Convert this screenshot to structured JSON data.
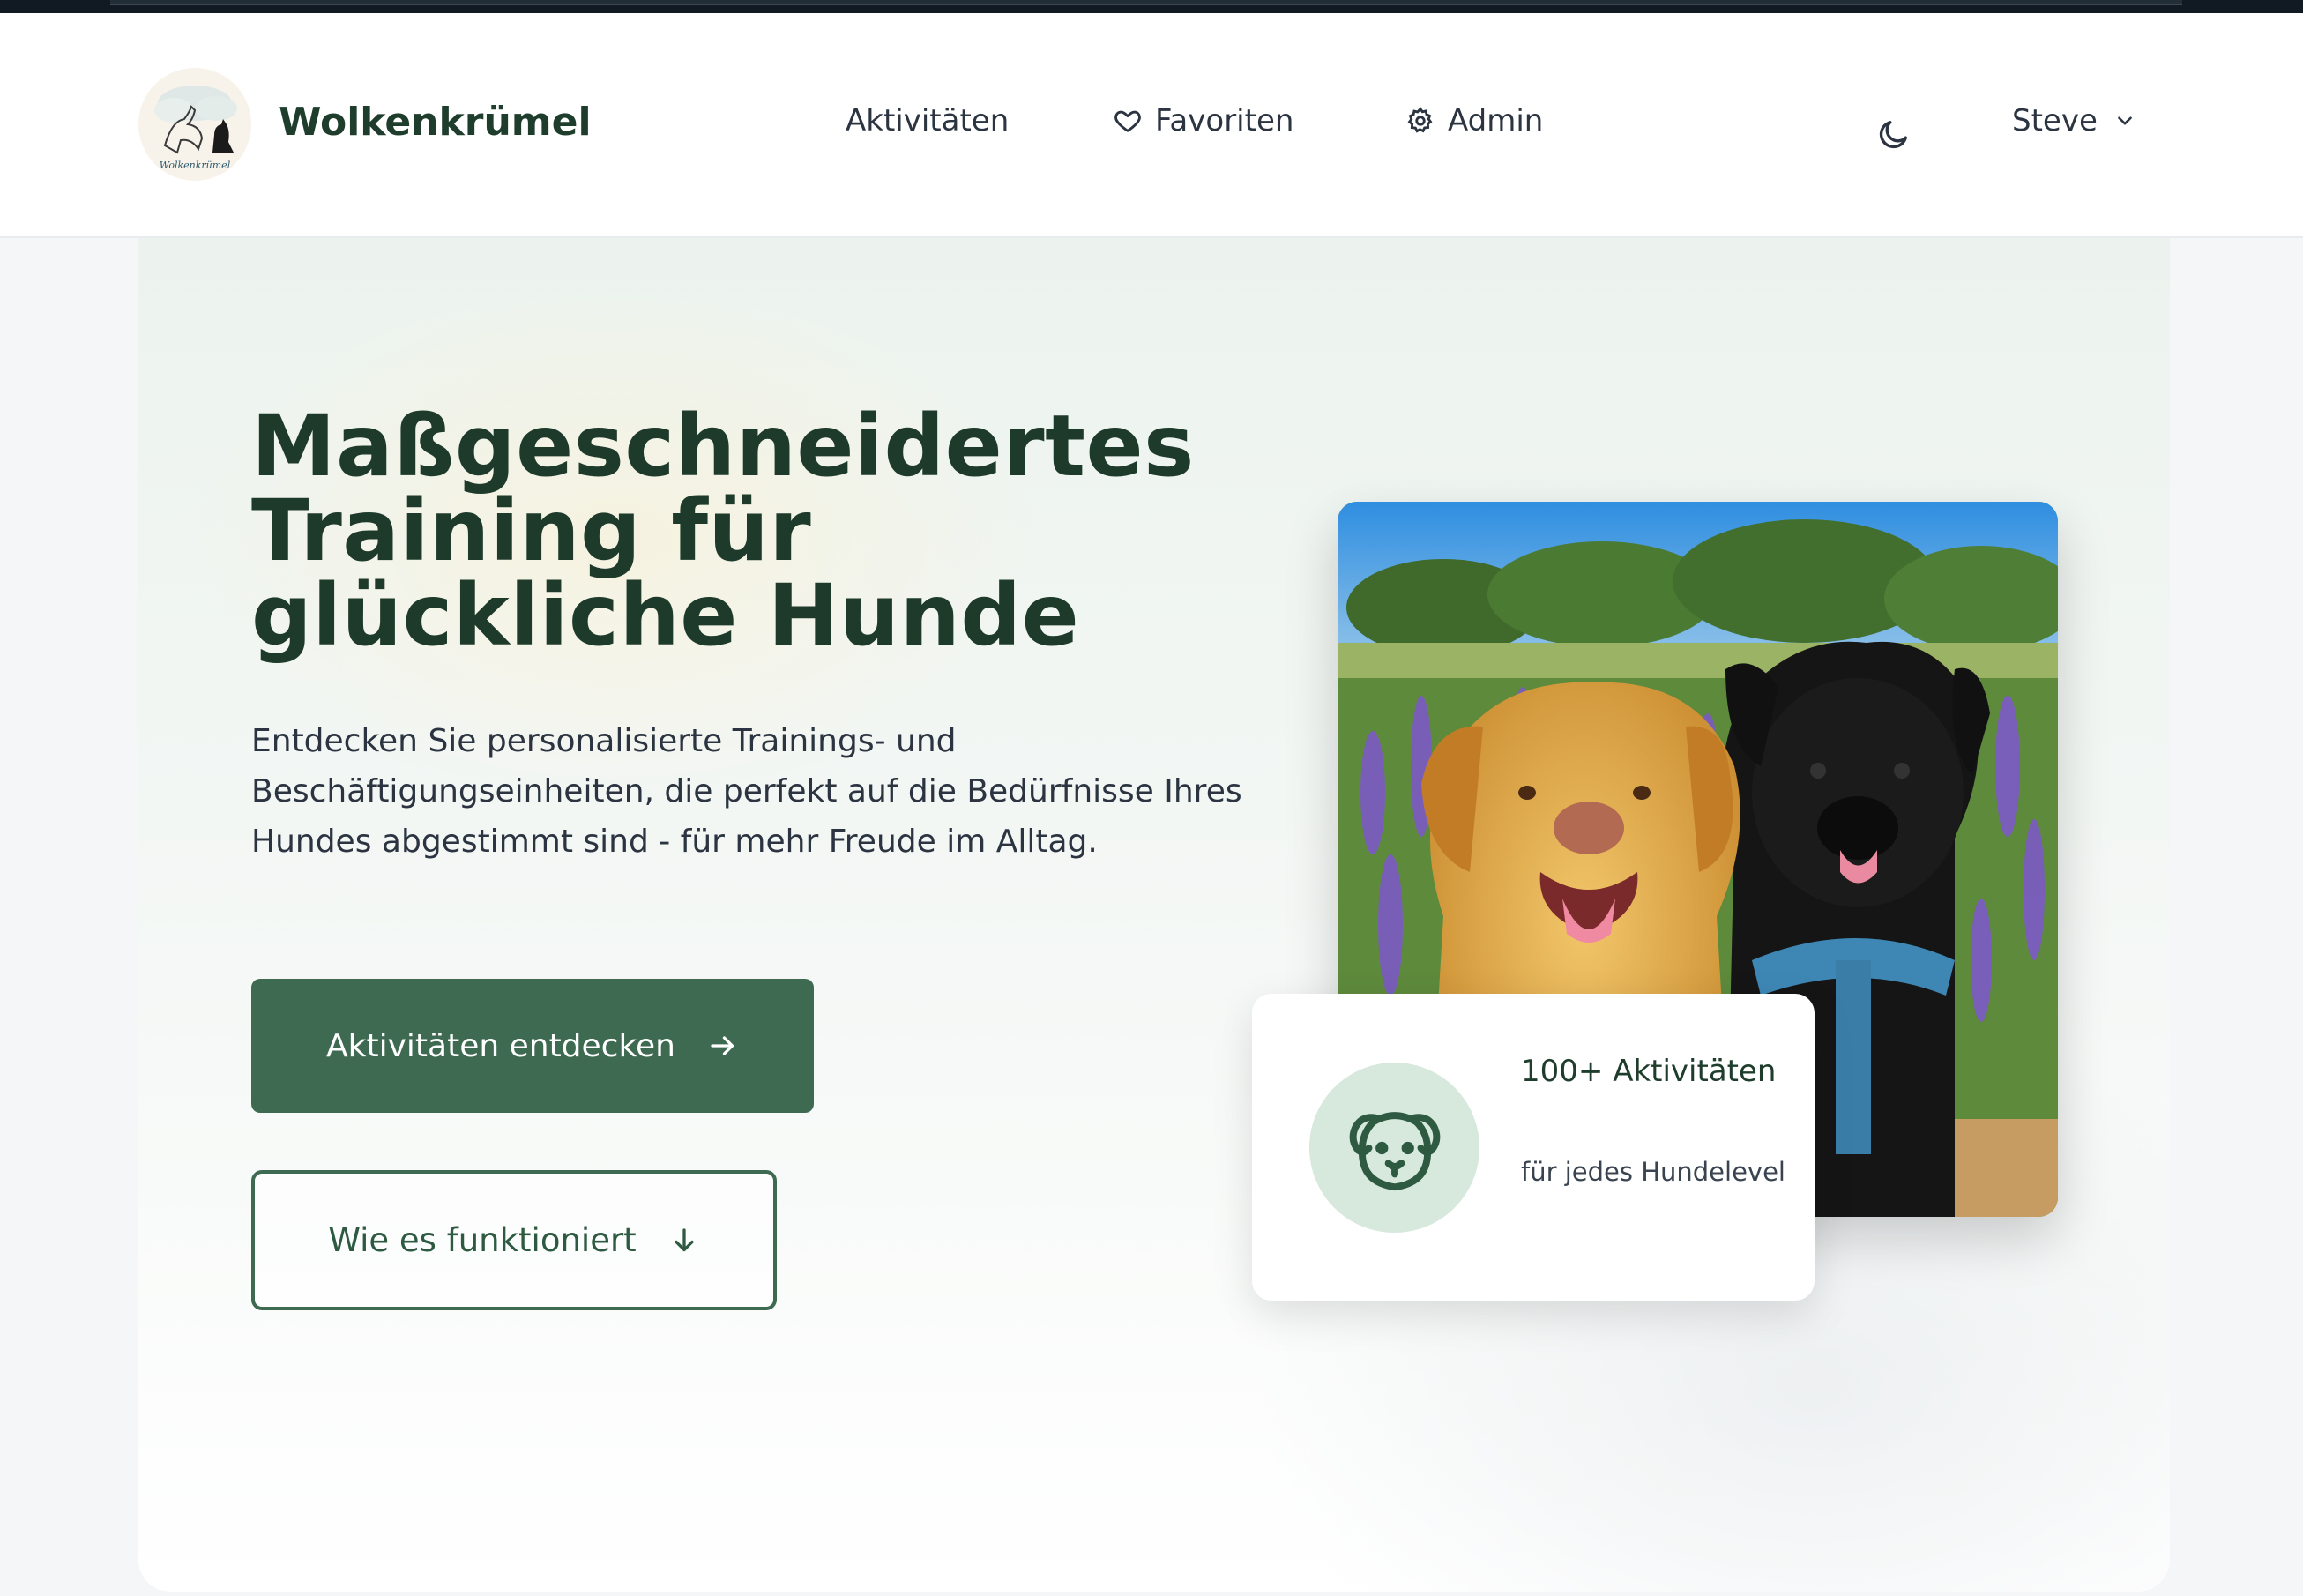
{
  "brand": {
    "name": "Wolkenkrümel",
    "logo_caption": "Wolkenkrümel"
  },
  "nav": {
    "activities": "Aktivitäten",
    "favorites": "Favoriten",
    "admin": "Admin"
  },
  "user": {
    "name": "Steve"
  },
  "hero": {
    "headline": "Maßgeschneidertes Training für glückliche Hunde",
    "subtext": "Entdecken Sie personalisierte Trainings- und Beschäftigungseinheiten, die perfekt auf die Bedürfnisse Ihres Hundes abgestimmt sind - für mehr Freude im Alltag.",
    "primary_button": "Aktivitäten entdecken",
    "secondary_button": "Wie es funktioniert"
  },
  "stat_card": {
    "title": "100+ Aktivitäten",
    "subtitle": "für jedes Hundelevel"
  },
  "colors": {
    "brand_green": "#3e6a51",
    "heading_green": "#1d3a2a",
    "icon_circle": "#d7e8dd"
  },
  "icons": [
    "heart-icon",
    "gear-icon",
    "moon-icon",
    "chevron-down-icon",
    "arrow-right-icon",
    "arrow-down-icon",
    "dog-face-icon"
  ]
}
